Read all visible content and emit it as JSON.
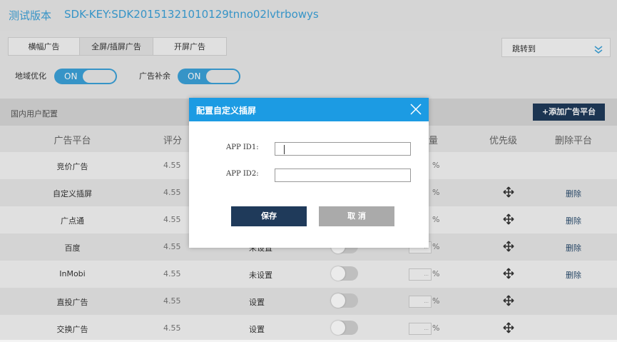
{
  "header": {
    "version": "测试版本",
    "sdk_key": "SDK-KEY:SDK20151321010129tnno02lvtrbowys"
  },
  "tabs": [
    {
      "label": "横幅广告",
      "active": false
    },
    {
      "label": "全屏/插屏广告",
      "active": true
    },
    {
      "label": "开屏广告",
      "active": false
    }
  ],
  "jump": {
    "label": "跳转到",
    "icon": "chevron-down-double-icon"
  },
  "options": {
    "region_label": "地域优化",
    "region_state": "ON",
    "fill_label": "广告补余",
    "fill_state": "ON"
  },
  "section": {
    "title": "国内用户配置",
    "add_button": "+添加广告平台"
  },
  "table": {
    "headers": [
      "广告平台",
      "评分",
      "量",
      "优先级",
      "删除平台"
    ],
    "rows": [
      {
        "name": "竞价广告",
        "score": "4.55",
        "setting": "",
        "pct": "",
        "move": false,
        "delete": ""
      },
      {
        "name": "自定义插屏",
        "score": "4.55",
        "setting": "",
        "pct": "",
        "move": true,
        "delete": "删除"
      },
      {
        "name": "广点通",
        "score": "4.55",
        "setting": "",
        "pct": "",
        "move": true,
        "delete": "删除"
      },
      {
        "name": "百度",
        "score": "4.55",
        "setting": "未设置",
        "pct": "...",
        "move": true,
        "delete": "删除"
      },
      {
        "name": "InMobi",
        "score": "4.55",
        "setting": "未设置",
        "pct": "...",
        "move": true,
        "delete": "删除"
      },
      {
        "name": "直投广告",
        "score": "4.55",
        "setting": "设置",
        "pct": "...",
        "move": true,
        "delete": ""
      },
      {
        "name": "交换广告",
        "score": "4.55",
        "setting": "设置",
        "pct": "...",
        "move": true,
        "delete": ""
      }
    ],
    "pct_suffix": "%"
  },
  "modal": {
    "title": "配置自定义插屏",
    "app_id1_label": "APP ID1:",
    "app_id1_value": "",
    "app_id2_label": "APP ID2:",
    "app_id2_value": "",
    "save_label": "保存",
    "cancel_label": "取 消"
  },
  "colors": {
    "accent": "#3ba1d8",
    "modal_header": "#1c9be3",
    "dark_button": "#1f3a5a"
  }
}
